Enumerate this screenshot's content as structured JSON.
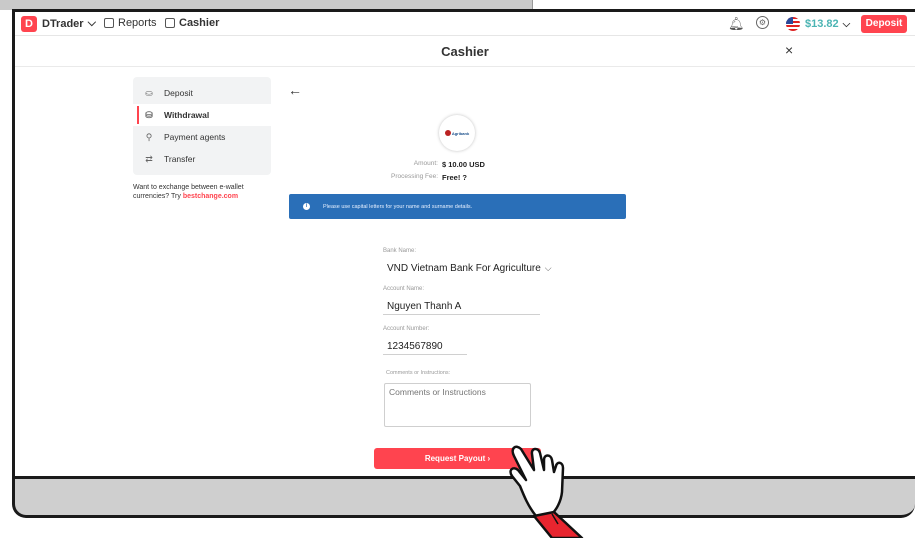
{
  "header": {
    "logo_letter": "D",
    "nav": [
      {
        "label": "DTrader"
      },
      {
        "label": "Reports"
      },
      {
        "label": "Cashier"
      }
    ],
    "balance": "$13.82",
    "deposit_label": "Deposit"
  },
  "cashier": {
    "title": "Cashier",
    "close_glyph": "×"
  },
  "sidebar": {
    "items": [
      {
        "label": "Deposit",
        "icon": "deposit-icon",
        "active": false
      },
      {
        "label": "Withdrawal",
        "icon": "withdrawal-icon",
        "active": true
      },
      {
        "label": "Payment agents",
        "icon": "payment-agents-icon",
        "active": false
      },
      {
        "label": "Transfer",
        "icon": "transfer-icon",
        "active": false
      }
    ],
    "exchange_note_prefix": "Want to exchange between e-wallet currencies? Try",
    "exchange_link": "bestchange.com"
  },
  "withdrawal": {
    "agent_logo_text": "Agribank",
    "amount_label": "Amount:",
    "amount_value": "$ 10.00 USD",
    "fee_label": "Processing Fee:",
    "fee_value": "Free! ?",
    "info_message": "Please use capital letters for your name and surname details.",
    "bank_label": "Bank Name:",
    "bank_value": "VND Vietnam Bank For Agriculture",
    "account_name_label": "Account Name:",
    "account_name_value": "Nguyen Thanh A",
    "account_number_label": "Account Number:",
    "account_number_value": "1234567890",
    "comments_label": "Comments or Instructions:",
    "comments_placeholder": "Comments or Instructions",
    "payout_label": "Request Payout ›"
  },
  "colors": {
    "brand_red": "#ff444f",
    "info_blue": "#2a6fb8",
    "balance_teal": "#4bb4b3"
  }
}
